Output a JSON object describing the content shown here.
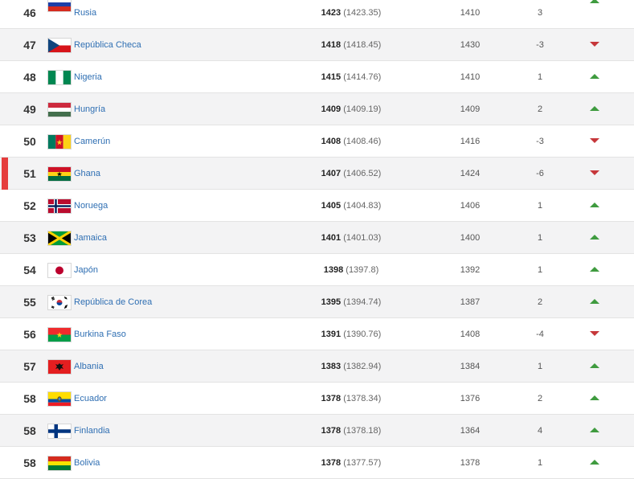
{
  "colors": {
    "up": "#3f9b3f",
    "down": "#c6373a",
    "link": "#2f6fb3",
    "highlight": "#e53d3d"
  },
  "rows": [
    {
      "rank": "46",
      "flag": "russia-flag-icon",
      "country": "Rusia",
      "points": "1423",
      "points_exact": "(1423.35)",
      "prev_points": "1410",
      "change": "3",
      "trend": "up"
    },
    {
      "rank": "47",
      "flag": "czech-republic-flag-icon",
      "country": "República Checa",
      "points": "1418",
      "points_exact": "(1418.45)",
      "prev_points": "1430",
      "change": "-3",
      "trend": "down"
    },
    {
      "rank": "48",
      "flag": "nigeria-flag-icon",
      "country": "Nigeria",
      "points": "1415",
      "points_exact": "(1414.76)",
      "prev_points": "1410",
      "change": "1",
      "trend": "up"
    },
    {
      "rank": "49",
      "flag": "hungary-flag-icon",
      "country": "Hungría",
      "points": "1409",
      "points_exact": "(1409.19)",
      "prev_points": "1409",
      "change": "2",
      "trend": "up"
    },
    {
      "rank": "50",
      "flag": "cameroon-flag-icon",
      "country": "Camerún",
      "points": "1408",
      "points_exact": "(1408.46)",
      "prev_points": "1416",
      "change": "-3",
      "trend": "down"
    },
    {
      "rank": "51",
      "flag": "ghana-flag-icon",
      "country": "Ghana",
      "points": "1407",
      "points_exact": "(1406.52)",
      "prev_points": "1424",
      "change": "-6",
      "trend": "down",
      "highlighted": true
    },
    {
      "rank": "52",
      "flag": "norway-flag-icon",
      "country": "Noruega",
      "points": "1405",
      "points_exact": "(1404.83)",
      "prev_points": "1406",
      "change": "1",
      "trend": "up"
    },
    {
      "rank": "53",
      "flag": "jamaica-flag-icon",
      "country": "Jamaica",
      "points": "1401",
      "points_exact": "(1401.03)",
      "prev_points": "1400",
      "change": "1",
      "trend": "up"
    },
    {
      "rank": "54",
      "flag": "japan-flag-icon",
      "country": "Japón",
      "points": "1398",
      "points_exact": "(1397.8)",
      "prev_points": "1392",
      "change": "1",
      "trend": "up"
    },
    {
      "rank": "55",
      "flag": "south-korea-flag-icon",
      "country": "República de Corea",
      "points": "1395",
      "points_exact": "(1394.74)",
      "prev_points": "1387",
      "change": "2",
      "trend": "up"
    },
    {
      "rank": "56",
      "flag": "burkina-faso-flag-icon",
      "country": "Burkina Faso",
      "points": "1391",
      "points_exact": "(1390.76)",
      "prev_points": "1408",
      "change": "-4",
      "trend": "down"
    },
    {
      "rank": "57",
      "flag": "albania-flag-icon",
      "country": "Albania",
      "points": "1383",
      "points_exact": "(1382.94)",
      "prev_points": "1384",
      "change": "1",
      "trend": "up"
    },
    {
      "rank": "58",
      "flag": "ecuador-flag-icon",
      "country": "Ecuador",
      "points": "1378",
      "points_exact": "(1378.34)",
      "prev_points": "1376",
      "change": "2",
      "trend": "up"
    },
    {
      "rank": "58",
      "flag": "finland-flag-icon",
      "country": "Finlandia",
      "points": "1378",
      "points_exact": "(1378.18)",
      "prev_points": "1364",
      "change": "4",
      "trend": "up"
    },
    {
      "rank": "58",
      "flag": "bolivia-flag-icon",
      "country": "Bolivia",
      "points": "1378",
      "points_exact": "(1377.57)",
      "prev_points": "1378",
      "change": "1",
      "trend": "up"
    }
  ]
}
